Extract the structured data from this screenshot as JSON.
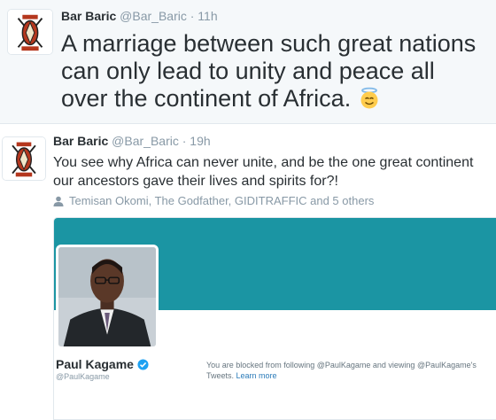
{
  "tweets": [
    {
      "name": "Bar Baric",
      "handle": "@Bar_Baric",
      "separator": "·",
      "time": "11h",
      "text": "A marriage between such great nations can only lead to unity and peace all over the continent of Africa.",
      "emoji": "smiling-face-with-halo-icon"
    },
    {
      "name": "Bar Baric",
      "handle": "@Bar_Baric",
      "separator": "·",
      "time": "19h",
      "text": "You see why Africa can never unite, and be the one great continent our ancestors gave their lives and spirits for?!",
      "social_context": "Temisan Okomi, The Godfather, GIDITRAFFIC and 5 others",
      "card": {
        "name": "Paul Kagame",
        "handle": "@PaulKagame",
        "blocked_text": "You are blocked from following @PaulKagame and viewing @PaulKagame's Tweets.",
        "learn_more": "Learn more",
        "banner_color": "#1b95a3"
      }
    }
  ],
  "colors": {
    "text": "#292f33",
    "secondary": "#8899a6",
    "link": "#2b7bb9",
    "verified": "#1da1f2"
  }
}
